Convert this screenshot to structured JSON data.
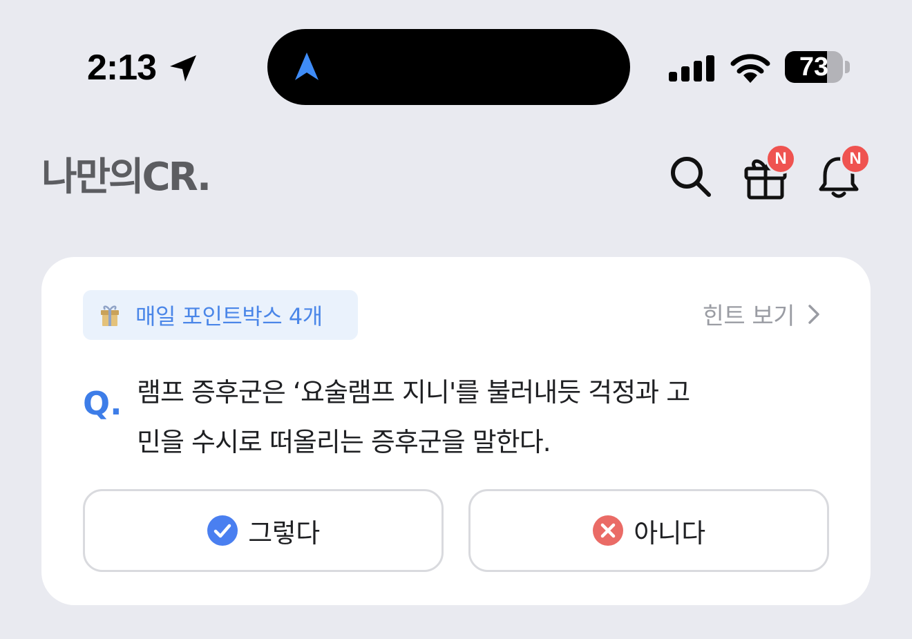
{
  "status_bar": {
    "time": "2:13",
    "battery_level": "73",
    "battery_fraction": 0.73,
    "island_icon": "navigation-arrow-icon"
  },
  "header": {
    "logo": "나만의CR.",
    "search_icon": "search-icon",
    "gift_icon": "gift-icon",
    "gift_badge": "N",
    "bell_icon": "bell-icon",
    "bell_badge": "N"
  },
  "quiz": {
    "pointbox_label": "매일 포인트박스 4개",
    "pointbox_icon": "gift-box-icon",
    "hint_label": "힌트 보기",
    "q_mark": "Q.",
    "question": "램프 증후군은 ‘요술램프 지니'를 불러내듯 걱정과 고\n민을 수시로 떠올리는 증후군을 말한다.",
    "answers": [
      {
        "label": "그렇다",
        "icon": "check-circle-icon",
        "color": "#4a7ff0"
      },
      {
        "label": "아니다",
        "icon": "x-circle-icon",
        "color": "#ea6b66"
      }
    ]
  },
  "colors": {
    "background": "#e9eaf0",
    "accent": "#3d7de8",
    "badge": "#ef5350"
  }
}
